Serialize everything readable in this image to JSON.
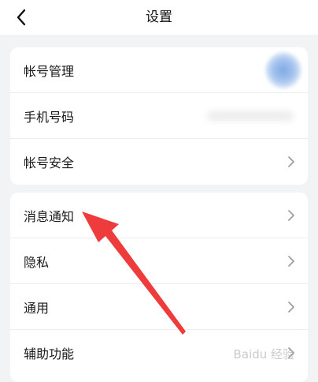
{
  "header": {
    "title": "设置"
  },
  "groups": [
    {
      "items": [
        {
          "label": "帐号管理"
        },
        {
          "label": "手机号码"
        },
        {
          "label": "帐号安全"
        }
      ]
    },
    {
      "items": [
        {
          "label": "消息通知"
        },
        {
          "label": "隐私"
        },
        {
          "label": "通用"
        },
        {
          "label": "辅助功能"
        }
      ]
    }
  ],
  "annotation": {
    "arrow_color": "#ee3b3b"
  },
  "watermark": {
    "text": "Baidu 经验"
  },
  "icons": {
    "back": "chevron-left-icon",
    "row": "chevron-right-icon"
  }
}
